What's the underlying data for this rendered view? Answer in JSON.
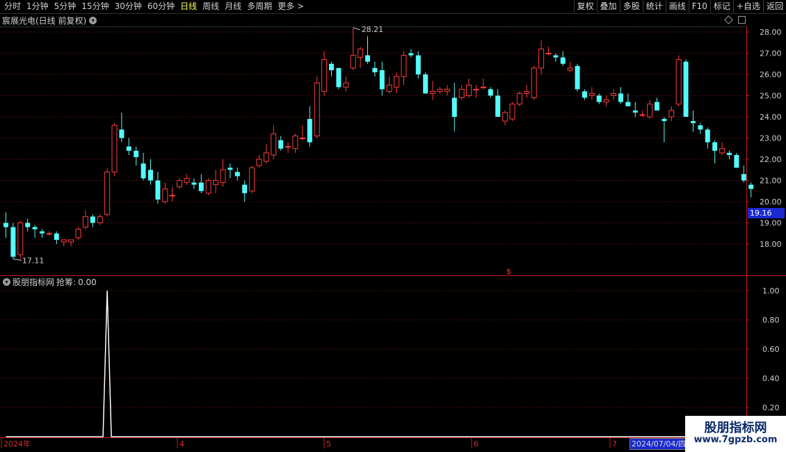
{
  "toolbar": {
    "left": [
      {
        "label": "分时",
        "active": false
      },
      {
        "label": "1分钟",
        "active": false
      },
      {
        "label": "5分钟",
        "active": false
      },
      {
        "label": "15分钟",
        "active": false
      },
      {
        "label": "30分钟",
        "active": false
      },
      {
        "label": "60分钟",
        "active": false
      },
      {
        "label": "日线",
        "active": true
      },
      {
        "label": "周线",
        "active": false
      },
      {
        "label": "月线",
        "active": false
      },
      {
        "label": "多周期",
        "active": false
      },
      {
        "label": "更多 >",
        "active": false
      }
    ],
    "right": [
      "复权",
      "叠加",
      "多股",
      "统计",
      "画线",
      "F10",
      "标记",
      "+自选",
      "返回"
    ]
  },
  "stock": {
    "title": "宸展光电(日线 前复权)"
  },
  "indicator": {
    "title": "股朋指标网",
    "param_label": "抢筹:",
    "param_value": "0.00"
  },
  "price_axis": {
    "labels": [
      "28.00",
      "27.00",
      "26.00",
      "25.00",
      "24.00",
      "23.00",
      "22.00",
      "21.00",
      "20.00",
      "19.00",
      "18.00"
    ],
    "current": "19.16"
  },
  "ind_axis": {
    "labels": [
      "1.00",
      "0.80",
      "0.60",
      "0.40",
      "0.20"
    ]
  },
  "annotations": {
    "high": "28.21",
    "low": "17.11",
    "marker": "$"
  },
  "time_axis": {
    "labels": [
      "2024年",
      "4",
      "5",
      "6",
      "7"
    ],
    "current_date": "2024/07/04/四"
  },
  "watermark": {
    "line1": "股朋指标网",
    "line2": "www.7gpzb.com"
  },
  "colors": {
    "up": "#ff3c3c",
    "down": "#54fcfc",
    "grid": "#8a1a1a",
    "axis": "#c81c1c",
    "signal": "#ffffff"
  },
  "chart_data": [
    {
      "type": "candlestick",
      "title": "宸展光电(日线 前复权)",
      "ylim": [
        17.0,
        28.3
      ],
      "candles": [
        [
          19.0,
          19.5,
          18.3,
          18.8
        ],
        [
          18.8,
          19.0,
          17.3,
          17.4
        ],
        [
          17.5,
          19.1,
          17.3,
          19.0
        ],
        [
          19.0,
          19.2,
          18.6,
          18.8
        ],
        [
          18.8,
          18.9,
          18.3,
          18.7
        ],
        [
          18.6,
          18.7,
          18.3,
          18.5
        ],
        [
          18.5,
          18.6,
          18.4,
          18.5
        ],
        [
          18.5,
          18.6,
          18.0,
          18.2
        ],
        [
          18.1,
          18.2,
          17.9,
          18.2
        ],
        [
          18.1,
          18.2,
          17.9,
          18.2
        ],
        [
          18.3,
          18.8,
          18.2,
          18.7
        ],
        [
          18.8,
          19.6,
          18.7,
          19.3
        ],
        [
          19.3,
          19.4,
          18.8,
          19.0
        ],
        [
          19.0,
          19.4,
          18.9,
          19.3
        ],
        [
          19.4,
          21.6,
          19.3,
          21.4
        ],
        [
          21.4,
          23.7,
          21.2,
          23.6
        ],
        [
          23.4,
          24.2,
          22.8,
          23.0
        ],
        [
          22.6,
          23.0,
          22.2,
          22.4
        ],
        [
          22.4,
          22.6,
          21.7,
          22.1
        ],
        [
          21.8,
          22.3,
          21.0,
          21.1
        ],
        [
          21.5,
          22.0,
          20.8,
          21.0
        ],
        [
          21.0,
          21.4,
          19.9,
          20.1
        ],
        [
          20.0,
          20.9,
          19.9,
          20.6
        ],
        [
          20.3,
          20.7,
          20.0,
          20.3
        ],
        [
          20.7,
          21.1,
          20.6,
          21.0
        ],
        [
          20.9,
          21.3,
          20.8,
          21.1
        ],
        [
          20.9,
          21.1,
          20.6,
          20.8
        ],
        [
          20.9,
          21.3,
          20.4,
          20.5
        ],
        [
          20.4,
          21.1,
          20.3,
          21.0
        ],
        [
          20.8,
          21.5,
          20.4,
          21.0
        ],
        [
          20.9,
          22.0,
          20.7,
          21.5
        ],
        [
          21.6,
          21.8,
          21.1,
          21.5
        ],
        [
          21.4,
          21.6,
          21.0,
          21.2
        ],
        [
          20.8,
          21.0,
          20.0,
          20.4
        ],
        [
          20.5,
          21.7,
          20.4,
          21.6
        ],
        [
          21.7,
          22.2,
          21.6,
          22.0
        ],
        [
          21.9,
          22.7,
          21.8,
          22.3
        ],
        [
          22.2,
          23.6,
          22.0,
          23.2
        ],
        [
          22.9,
          23.1,
          22.4,
          22.5
        ],
        [
          22.6,
          22.8,
          22.3,
          22.6
        ],
        [
          22.5,
          23.2,
          22.3,
          23.1
        ],
        [
          23.0,
          23.6,
          22.9,
          23.0
        ],
        [
          23.9,
          24.5,
          22.6,
          22.8
        ],
        [
          23.1,
          25.9,
          23.0,
          25.6
        ],
        [
          25.2,
          27.1,
          25.0,
          26.7
        ],
        [
          26.5,
          26.6,
          25.9,
          26.2
        ],
        [
          26.3,
          26.3,
          25.3,
          25.4
        ],
        [
          25.4,
          25.9,
          25.2,
          25.6
        ],
        [
          26.3,
          28.2,
          26.2,
          26.9
        ],
        [
          26.8,
          27.3,
          26.3,
          27.2
        ],
        [
          26.9,
          27.8,
          26.5,
          26.6
        ],
        [
          26.3,
          26.6,
          25.9,
          26.1
        ],
        [
          26.2,
          26.6,
          25.0,
          25.3
        ],
        [
          25.2,
          25.9,
          25.1,
          25.5
        ],
        [
          25.4,
          26.1,
          25.1,
          25.9
        ],
        [
          25.9,
          27.1,
          25.5,
          26.9
        ],
        [
          27.0,
          27.2,
          26.8,
          26.9
        ],
        [
          26.9,
          27.1,
          25.8,
          26.0
        ],
        [
          26.0,
          26.1,
          25.1,
          25.1
        ],
        [
          25.1,
          25.7,
          24.8,
          25.2
        ],
        [
          25.2,
          25.4,
          25.1,
          25.3
        ],
        [
          25.2,
          25.5,
          25.0,
          25.3
        ],
        [
          24.9,
          25.6,
          23.3,
          24.0
        ],
        [
          24.9,
          25.5,
          24.8,
          25.3
        ],
        [
          25.0,
          25.8,
          24.9,
          25.5
        ],
        [
          25.3,
          25.5,
          24.9,
          25.3
        ],
        [
          25.4,
          25.8,
          25.3,
          25.4
        ],
        [
          25.3,
          25.4,
          24.9,
          25.0
        ],
        [
          25.0,
          25.3,
          24.1,
          24.0
        ],
        [
          23.8,
          24.3,
          23.6,
          24.2
        ],
        [
          23.9,
          24.7,
          23.8,
          24.6
        ],
        [
          24.6,
          25.2,
          24.5,
          25.1
        ],
        [
          25.1,
          25.5,
          24.9,
          25.2
        ],
        [
          24.9,
          26.4,
          24.8,
          26.3
        ],
        [
          26.3,
          27.6,
          26.0,
          27.2
        ],
        [
          27.0,
          27.3,
          26.9,
          27.0
        ],
        [
          26.9,
          27.0,
          26.6,
          26.8
        ],
        [
          26.8,
          27.1,
          26.4,
          26.5
        ],
        [
          26.2,
          26.6,
          26.1,
          26.3
        ],
        [
          26.4,
          26.5,
          25.2,
          25.3
        ],
        [
          25.2,
          25.3,
          24.8,
          24.9
        ],
        [
          25.0,
          25.4,
          24.8,
          25.1
        ],
        [
          25.0,
          25.1,
          24.6,
          24.7
        ],
        [
          24.7,
          25.0,
          24.5,
          24.8
        ],
        [
          25.0,
          25.3,
          24.8,
          25.1
        ],
        [
          25.1,
          25.4,
          24.6,
          24.7
        ],
        [
          24.7,
          25.1,
          24.6,
          24.5
        ],
        [
          24.3,
          24.7,
          24.0,
          24.2
        ],
        [
          24.1,
          24.3,
          24.0,
          24.1
        ],
        [
          24.0,
          24.8,
          23.9,
          24.6
        ],
        [
          24.7,
          24.9,
          24.3,
          24.3
        ],
        [
          23.9,
          24.0,
          22.8,
          23.8
        ],
        [
          24.0,
          24.5,
          23.8,
          24.3
        ],
        [
          24.6,
          26.9,
          24.5,
          26.7
        ],
        [
          26.6,
          26.7,
          24.0,
          24.0
        ],
        [
          23.8,
          24.3,
          23.3,
          23.7
        ],
        [
          23.6,
          23.7,
          23.2,
          23.4
        ],
        [
          23.4,
          23.5,
          22.5,
          22.8
        ],
        [
          22.8,
          22.9,
          21.8,
          22.4
        ],
        [
          22.3,
          22.8,
          22.2,
          22.5
        ],
        [
          22.3,
          22.4,
          22.0,
          22.2
        ],
        [
          22.2,
          22.3,
          21.6,
          21.6
        ],
        [
          21.3,
          21.7,
          20.9,
          21.0
        ],
        [
          20.8,
          20.9,
          20.2,
          20.6
        ]
      ]
    },
    {
      "type": "line",
      "title": "股朋指标网 抢筹",
      "ylim": [
        0.0,
        1.05
      ],
      "series": [
        {
          "name": "抢筹",
          "values": [
            0,
            0,
            0,
            0,
            0,
            0,
            0,
            0,
            0,
            0,
            0,
            0,
            0,
            0,
            1,
            0,
            0,
            0,
            0,
            0,
            0,
            0,
            0,
            0,
            0,
            0,
            0,
            0,
            0,
            0,
            0,
            0,
            0,
            0,
            0,
            0,
            0,
            0,
            0,
            0,
            0,
            0,
            0,
            0,
            0,
            0,
            0,
            0,
            0,
            0,
            0,
            0,
            0,
            0,
            0,
            0,
            0,
            0,
            0,
            0,
            0,
            0,
            0,
            0,
            0,
            0,
            0,
            0,
            0,
            0,
            0,
            0,
            0,
            0,
            0,
            0,
            0,
            0,
            0,
            0,
            0,
            0,
            0,
            0,
            0,
            0,
            0,
            0,
            0,
            0,
            0,
            0,
            0,
            0,
            0,
            0,
            0,
            0,
            0,
            0,
            0,
            0,
            0,
            0
          ]
        }
      ]
    }
  ]
}
